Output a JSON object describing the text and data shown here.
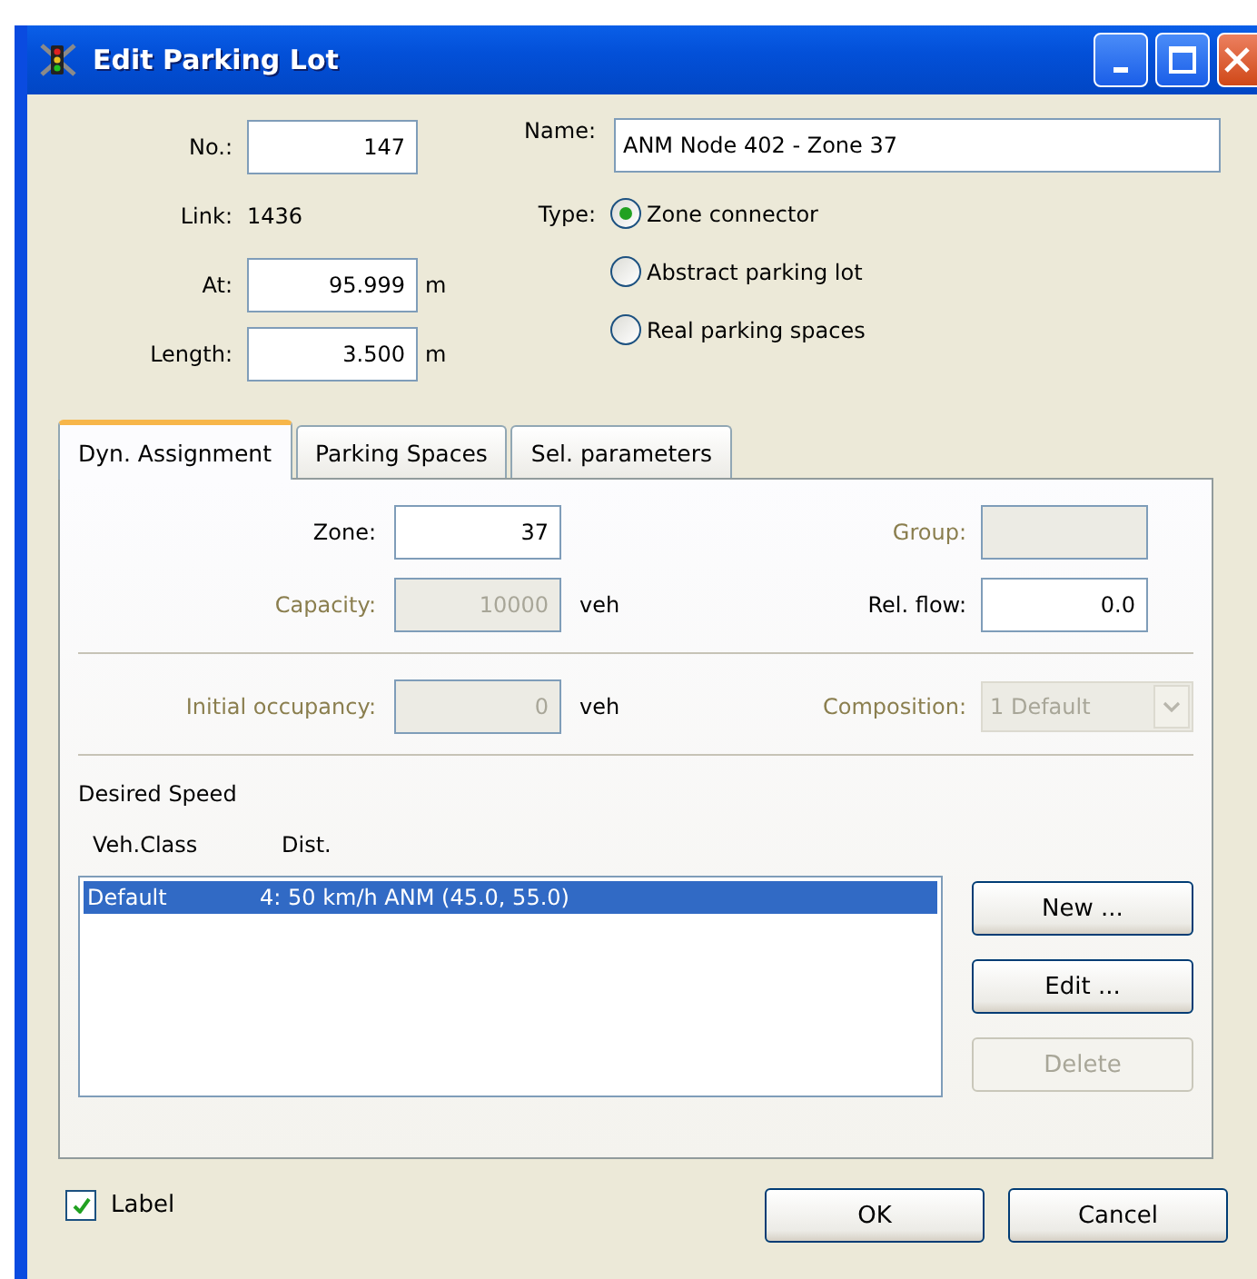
{
  "window": {
    "title": "Edit Parking Lot"
  },
  "general": {
    "number": {
      "label": "No.:",
      "value": "147"
    },
    "link": {
      "label": "Link:",
      "value": "1436"
    },
    "at": {
      "label": "At:",
      "value": "95.999",
      "unit": "m"
    },
    "length": {
      "label": "Length:",
      "value": "3.500",
      "unit": "m"
    },
    "name": {
      "label": "Name:",
      "value": "ANM Node 402 - Zone 37"
    },
    "type": {
      "label": "Type:",
      "options": [
        {
          "label": "Zone connector",
          "selected": true
        },
        {
          "label": "Abstract parking lot",
          "selected": false
        },
        {
          "label": "Real parking spaces",
          "selected": false
        }
      ]
    }
  },
  "tabs": [
    {
      "label": "Dyn. Assignment",
      "selected": true
    },
    {
      "label": "Parking Spaces",
      "selected": false
    },
    {
      "label": "Sel. parameters",
      "selected": false
    }
  ],
  "assignment": {
    "sections": [
      {
        "rows": [
          {
            "left": {
              "label": "Zone:",
              "value": "37",
              "disabled": false
            },
            "right": {
              "kind": "text",
              "label": "Group:",
              "disabled": true
            }
          },
          {
            "left": {
              "label": "Capacity:",
              "value": "10000",
              "unit": "veh",
              "disabled": true
            },
            "right": {
              "kind": "text",
              "label": "Rel. flow:",
              "value": "0.0",
              "disabled": false
            }
          }
        ]
      },
      {
        "rows": [
          {
            "left": {
              "label": "Initial occupancy:",
              "value": "0",
              "unit": "veh",
              "disabled": true
            },
            "right": {
              "kind": "combo",
              "label": "Composition:",
              "value": "1 Default",
              "disabled": true
            }
          }
        ]
      }
    ]
  },
  "desired_speed": {
    "title": "Desired Speed",
    "columns": [
      "Veh.Class",
      "Dist."
    ],
    "rows": [
      {
        "veh_class": "Default",
        "dist": "4: 50 km/h ANM (45.0, 55.0)",
        "selected": true
      }
    ],
    "buttons": [
      {
        "label": "New ...",
        "disabled": false
      },
      {
        "label": "Edit ...",
        "disabled": false
      },
      {
        "label": "Delete",
        "disabled": true
      }
    ]
  },
  "footer": {
    "label_checkbox": {
      "label": "Label",
      "checked": true
    },
    "buttons": [
      "OK",
      "Cancel"
    ]
  }
}
